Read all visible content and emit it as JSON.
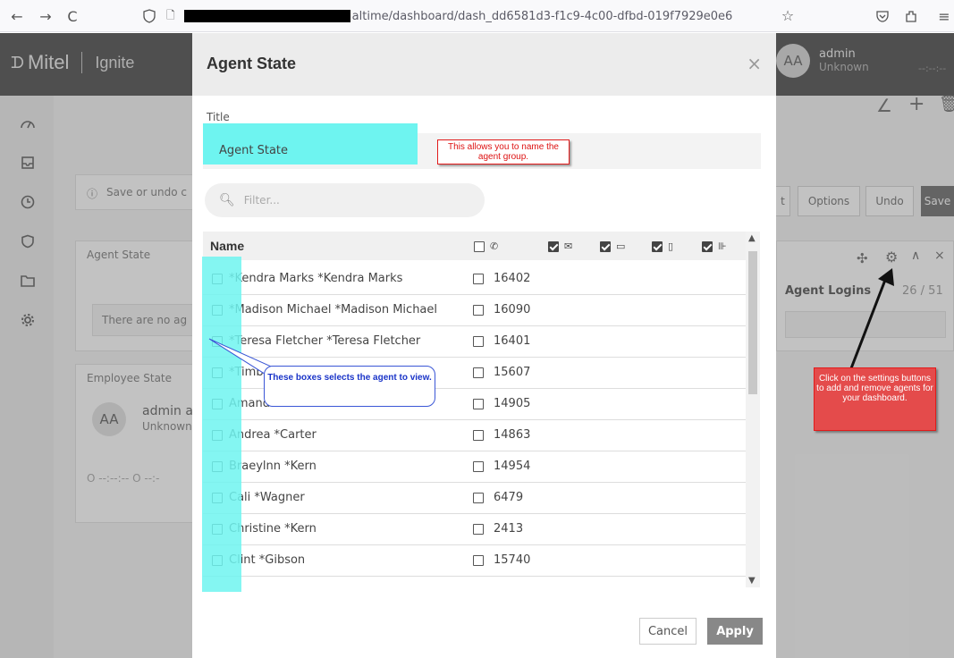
{
  "browser": {
    "url_visible": "altime/dashboard/dash_dd6581d3-f1c9-4c00-dfbd-019f7929e0e6",
    "back": "←",
    "forward": "→",
    "reload": "C",
    "star": "☆",
    "pocket": "⊘",
    "ext": "⇪",
    "menu": "≡"
  },
  "app": {
    "brand": "Mitel",
    "brand_sub": "Ignite",
    "user_avatar": "AA",
    "user_name": "admin",
    "user_status": "Unknown",
    "time": "--:--:--"
  },
  "background": {
    "save_undo": "Save or undo c",
    "agent_state_panel": "Agent State",
    "no_agents": "There are no ag",
    "employee_state_panel": "Employee State",
    "emp_avatar": "AA",
    "emp_name": "admin a",
    "emp_status": "Unknown",
    "emp_times": "O --:--:--  O --:-",
    "btn_t": "t",
    "btn_options": "Options",
    "btn_undo": "Undo",
    "btn_save": "Save",
    "agent_logins_label": "Agent Logins",
    "agent_logins_value": "26 / 51"
  },
  "modal": {
    "title": "Agent State",
    "close": "×",
    "field_label": "Title",
    "title_value": "Agent State",
    "filter_placeholder": "Filter...",
    "col_name": "Name",
    "rows": [
      {
        "name": "*Kendra Marks *Kendra Marks",
        "ext": "16402"
      },
      {
        "name": "*Madison Michael *Madison Michael",
        "ext": "16090"
      },
      {
        "name": "*Teresa Fletcher *Teresa Fletcher",
        "ext": "16401"
      },
      {
        "name": "*Timb",
        "ext": "15607"
      },
      {
        "name": "Amanda *Wiseman",
        "ext": "14905"
      },
      {
        "name": "Andrea *Carter",
        "ext": "14863"
      },
      {
        "name": "Braeylnn *Kern",
        "ext": "14954"
      },
      {
        "name": "Cali *Wagner",
        "ext": "6479"
      },
      {
        "name": "Christine *Kern",
        "ext": "2413"
      },
      {
        "name": "Clint *Gibson",
        "ext": "15740"
      }
    ],
    "cancel": "Cancel",
    "apply": "Apply"
  },
  "annotations": {
    "name_note": "This allows you to name the agent group.",
    "boxes_note": "These boxes selects the agent to view.",
    "settings_note": "Click on the settings buttons to add and remove agents for your dashboard."
  },
  "colors": {
    "highlight": "#6ef4f0",
    "topbar": "#2e2e2e",
    "annotation_red": "#e21b1b",
    "annotation_blue": "#3a56d6"
  }
}
